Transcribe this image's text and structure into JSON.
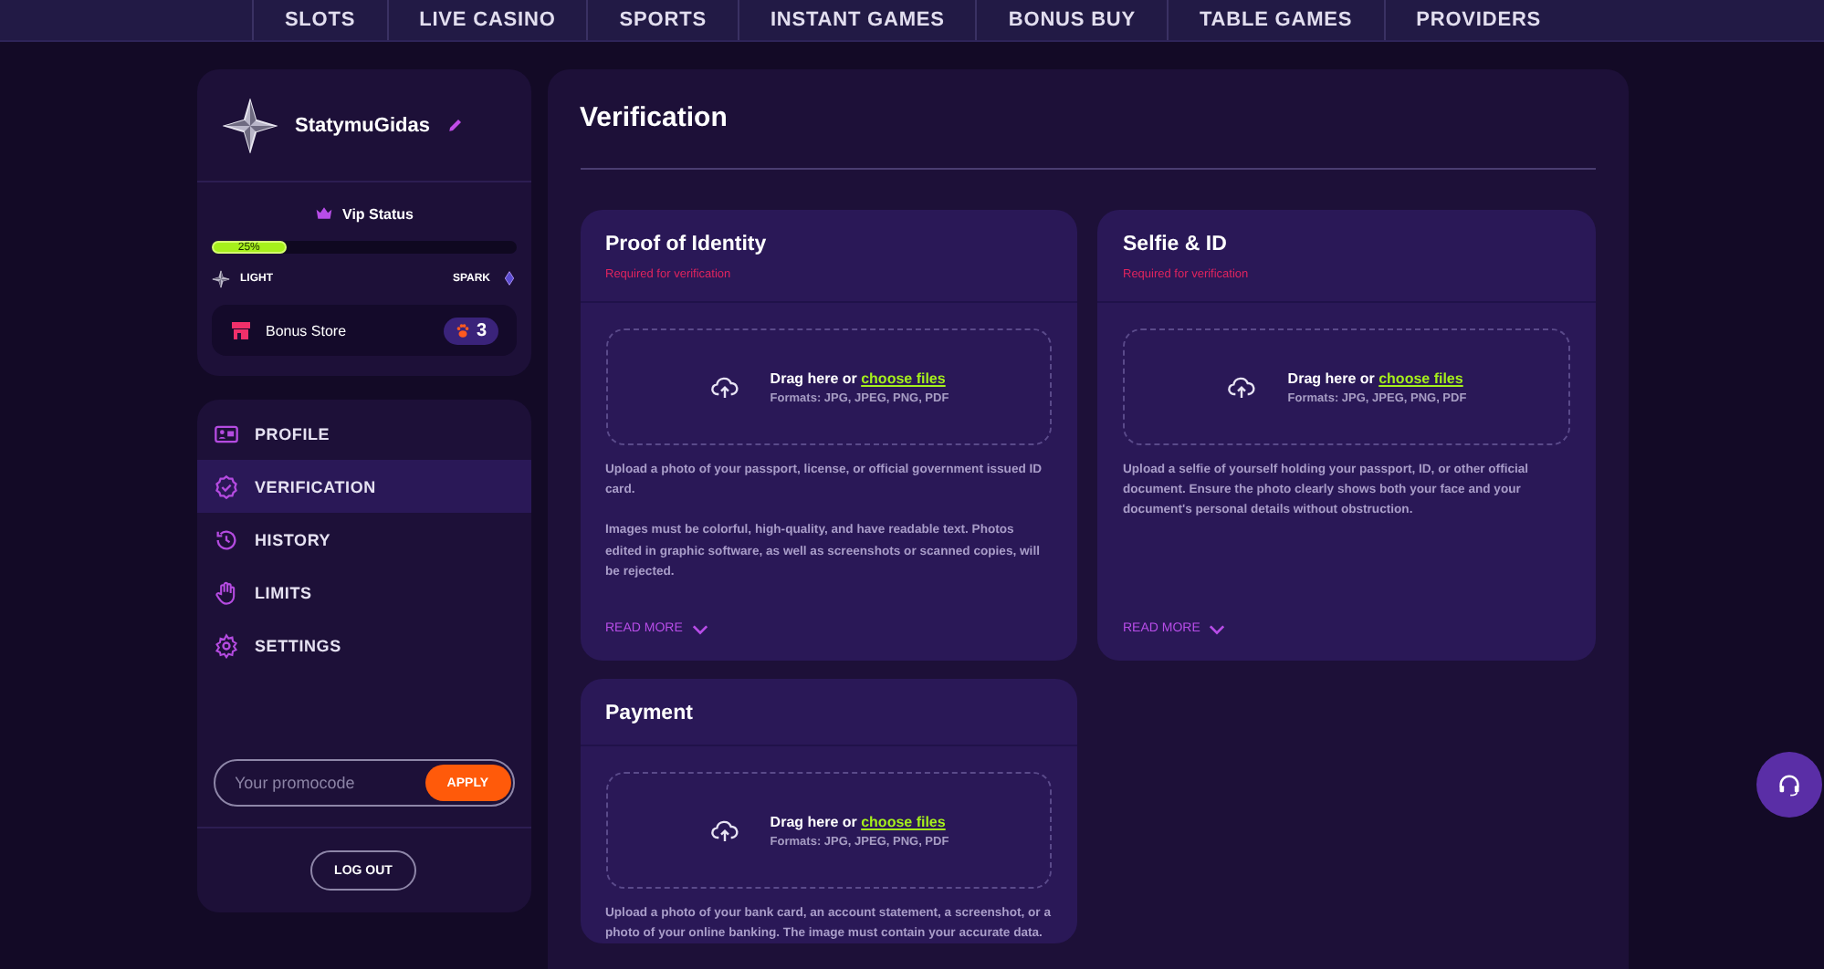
{
  "top_nav": {
    "items": [
      {
        "label": "SLOTS"
      },
      {
        "label": "LIVE CASINO"
      },
      {
        "label": "SPORTS"
      },
      {
        "label": "INSTANT GAMES"
      },
      {
        "label": "BONUS BUY"
      },
      {
        "label": "TABLE GAMES"
      },
      {
        "label": "PROVIDERS"
      }
    ]
  },
  "profile": {
    "username": "StatymuGidas",
    "vip_label": "Vip Status",
    "vip_progress": {
      "level": 0.25,
      "reading": "25%"
    },
    "tier_current": "LIGHT",
    "tier_next": "SPARK",
    "bonus_store": {
      "label": "Bonus Store",
      "count": "3"
    }
  },
  "menu": {
    "items": [
      {
        "kind": "profile",
        "label": "PROFILE",
        "selected": false
      },
      {
        "kind": "verification",
        "label": "VERIFICATION",
        "selected": true
      },
      {
        "kind": "history",
        "label": "HISTORY",
        "selected": false
      },
      {
        "kind": "limits",
        "label": "LIMITS",
        "selected": false
      },
      {
        "kind": "settings",
        "label": "SETTINGS",
        "selected": false
      }
    ],
    "promocode": {
      "placeholder": "Your promocode",
      "button": "APPLY"
    },
    "logout": "LOG OUT"
  },
  "main": {
    "title": "Verification",
    "cards": [
      {
        "title": "Proof of Identity",
        "subtitle": "Required for verification",
        "drop_text": "Drag here or",
        "drop_link": "choose files",
        "formats": "Formats: JPG, JPEG, PNG, PDF",
        "description": [
          "Upload a photo of your passport, license, or official government issued ID card.",
          "Images must be colorful, high-quality, and have readable text. Photos edited in graphic software, as well as screenshots or scanned copies, will be rejected."
        ],
        "read_more": "READ MORE"
      },
      {
        "title": "Selfie & ID",
        "subtitle": "Required for verification",
        "drop_text": "Drag here or",
        "drop_link": "choose files",
        "formats": "Formats: JPG, JPEG, PNG, PDF",
        "description": [
          "Upload a selfie of yourself holding your passport, ID, or other official document. Ensure the photo clearly shows both your face and your document's personal details without obstruction."
        ],
        "read_more": "READ MORE"
      },
      {
        "title": "Payment",
        "drop_text": "Drag here or",
        "drop_link": "choose files",
        "formats": "Formats: JPG, JPEG, PNG, PDF",
        "description": [
          "Upload a photo of your bank card, an account statement, a screenshot, or a photo of your online banking. The image must contain your accurate data."
        ]
      }
    ]
  }
}
